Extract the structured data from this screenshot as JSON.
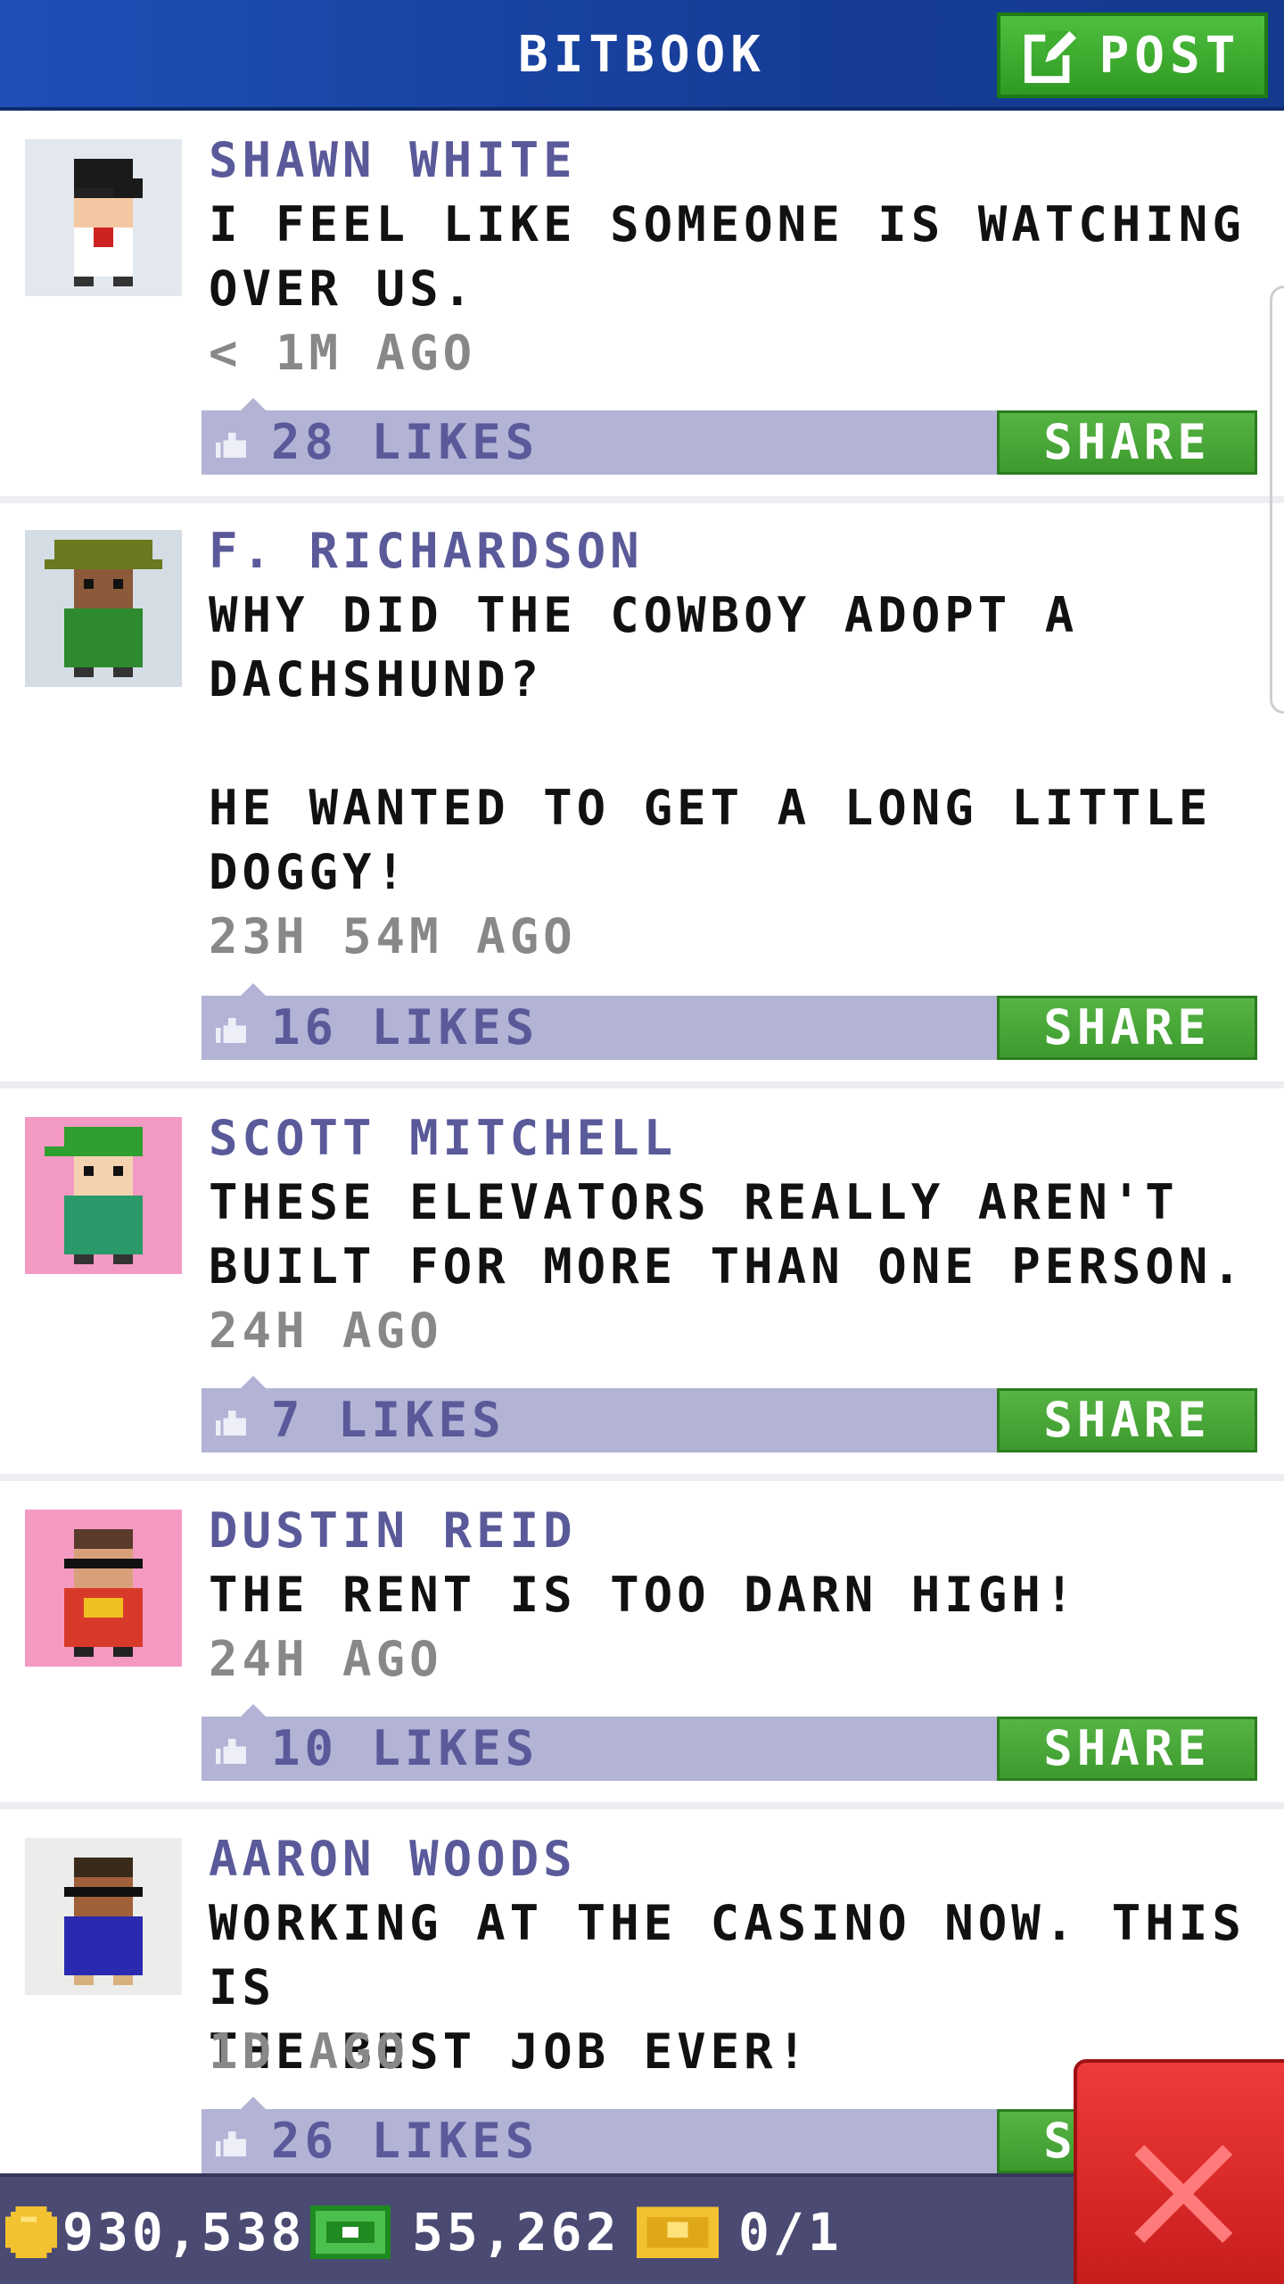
{
  "header": {
    "title": "BITBOOK",
    "post_label": "POST",
    "post_icon": "edit-icon"
  },
  "posts": [
    {
      "author": "SHAWN WHITE",
      "text": "I FEEL LIKE SOMEONE IS WATCHING\nOVER US.",
      "time": "< 1M AGO",
      "likes": "28 LIKES",
      "share": "SHARE",
      "avatar_bg": "#e2e8ee"
    },
    {
      "author": "F. RICHARDSON",
      "text": "WHY DID THE COWBOY ADOPT A\nDACHSHUND?\n\nHE WANTED TO GET A LONG LITTLE\nDOGGY!",
      "time": "23H 54M AGO",
      "likes": "16 LIKES",
      "share": "SHARE",
      "avatar_bg": "#d4dce4"
    },
    {
      "author": "SCOTT MITCHELL",
      "text": "THESE ELEVATORS REALLY AREN'T\nBUILT FOR MORE THAN ONE PERSON.",
      "time": "24H AGO",
      "likes": "7 LIKES",
      "share": "SHARE",
      "avatar_bg": "#f29ac3"
    },
    {
      "author": "DUSTIN REID",
      "text": "THE RENT IS TOO DARN HIGH!",
      "time": "24H AGO",
      "likes": "10 LIKES",
      "share": "SHARE",
      "avatar_bg": "#f49ac2"
    },
    {
      "author": "AARON WOODS",
      "text": "WORKING AT THE CASINO NOW. THIS IS\nTHE BEST JOB EVER!",
      "time": "1D AGO",
      "likes": "26 LIKES",
      "share": "SHARE",
      "avatar_bg": "#ececea"
    }
  ],
  "footer": {
    "coins": "930,538",
    "bux": "55,262",
    "tickets": "0/1",
    "coin_icon": "coin-icon",
    "bux_icon": "bux-icon",
    "ticket_icon": "ticket-icon"
  },
  "close_icon": "close-icon",
  "colors": {
    "header_blue": "#1f4fb7",
    "share_green": "#3d9a2d",
    "likes_bar": "#b3b3d6",
    "author_purple": "#5a5a9a",
    "close_red": "#e02a2a",
    "footer": "#4a4a73"
  }
}
